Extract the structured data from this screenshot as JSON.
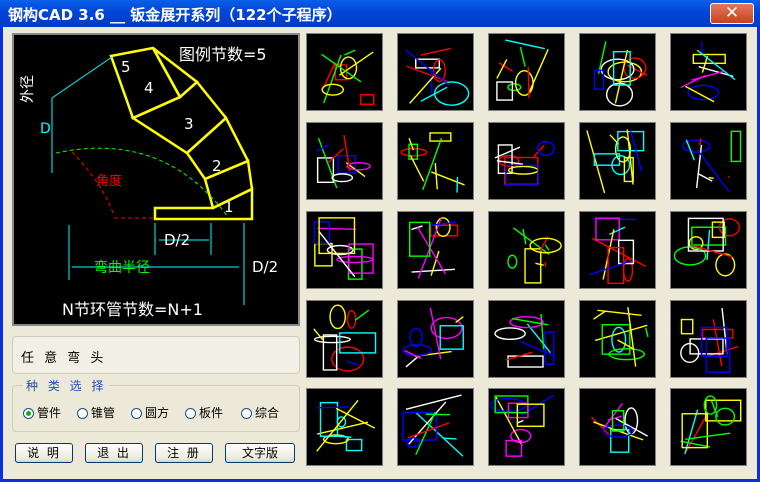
{
  "window": {
    "title": "钢构CAD 3.6 __ 钣金展开系列（122个子程序）",
    "close_glyph": "✕"
  },
  "preview": {
    "legend_text": "图例节数=5",
    "outer_diameter_label": "外径",
    "diameter_symbol": "D",
    "angle_label": "角度",
    "segment_numbers": [
      "1",
      "2",
      "3",
      "4",
      "5"
    ],
    "half_d_label": "D/2",
    "bend_radius_label": "弯曲半径",
    "half_d_label_right": "D/2",
    "formula": "N节环管节数=N+1"
  },
  "selected_item_name": "任 意 弯 头",
  "category_group": {
    "title": "种 类 选 择",
    "options": [
      "管件",
      "锥管",
      "圆方",
      "板件",
      "综合"
    ],
    "selected": "管件"
  },
  "buttons": {
    "help": "说 明",
    "exit": "退 出",
    "register": "注 册",
    "text_version": "文字版"
  },
  "colors": {
    "titlebar": "#0347d9",
    "cad_yellow": "#ffff00",
    "cad_cyan": "#00ffff",
    "cad_red": "#ff0000",
    "cad_green": "#00ff00"
  }
}
